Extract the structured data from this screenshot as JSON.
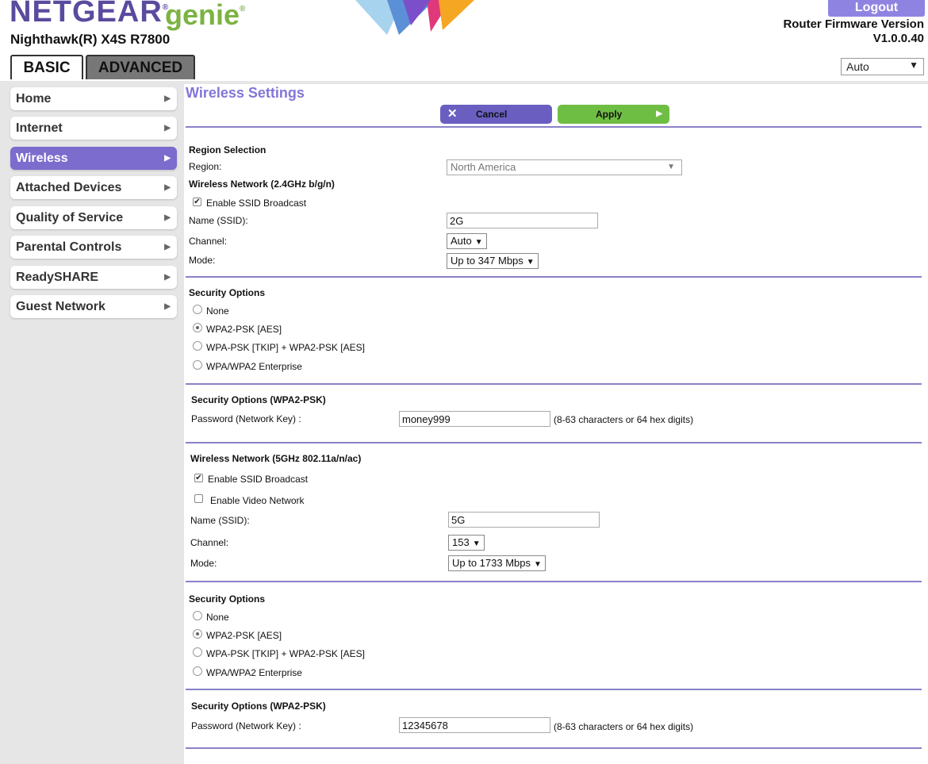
{
  "header": {
    "brand": "NETGEAR",
    "brand_mark": "®",
    "product": "genie",
    "product_mark": "®",
    "model": "Nighthawk(R) X4S R7800",
    "logout_label": "Logout",
    "firmware_label": "Router Firmware Version",
    "firmware_version": "V1.0.0.40",
    "colors": {
      "brand": "#5b4b9e",
      "genie": "#7cb342",
      "accent": "#7b6cce",
      "apply": "#6fbe44"
    }
  },
  "tabs": [
    {
      "label": "BASIC",
      "active": true
    },
    {
      "label": "ADVANCED",
      "active": false
    }
  ],
  "language": {
    "value": "Auto"
  },
  "sidebar": {
    "items": [
      {
        "label": "Home",
        "active": false
      },
      {
        "label": "Internet",
        "active": false
      },
      {
        "label": "Wireless",
        "active": true
      },
      {
        "label": "Attached Devices",
        "active": false
      },
      {
        "label": "Quality of Service",
        "active": false
      },
      {
        "label": "Parental Controls",
        "active": false
      },
      {
        "label": "ReadySHARE",
        "active": false
      },
      {
        "label": "Guest Network",
        "active": false
      }
    ]
  },
  "main": {
    "title": "Wireless Settings",
    "cancel_label": "Cancel",
    "apply_label": "Apply",
    "region": {
      "heading": "Region Selection",
      "label": "Region:",
      "value": "North America"
    },
    "net24": {
      "heading": "Wireless Network (2.4GHz b/g/n)",
      "enable_ssid": "Enable SSID Broadcast",
      "enable_ssid_checked": true,
      "name_label": "Name (SSID):",
      "name_value": "2G",
      "channel_label": "Channel:",
      "channel_value": "Auto",
      "mode_label": "Mode:",
      "mode_value": "Up to 347 Mbps"
    },
    "sec24": {
      "heading": "Security Options",
      "options": [
        "None",
        "WPA2-PSK [AES]",
        "WPA-PSK [TKIP] + WPA2-PSK [AES]",
        "WPA/WPA2 Enterprise"
      ],
      "selected": 1
    },
    "psk24": {
      "heading": "Security Options (WPA2-PSK)",
      "label": "Password (Network Key) :",
      "value": "money999",
      "hint": "(8-63 characters or 64 hex digits)"
    },
    "net5": {
      "heading": "Wireless Network (5GHz 802.11a/n/ac)",
      "enable_ssid": "Enable SSID Broadcast",
      "enable_ssid_checked": true,
      "enable_video": "Enable Video Network",
      "enable_video_checked": false,
      "name_label": "Name (SSID):",
      "name_value": "5G",
      "channel_label": "Channel:",
      "channel_value": "153",
      "mode_label": "Mode:",
      "mode_value": "Up to 1733 Mbps"
    },
    "sec5": {
      "heading": "Security Options",
      "options": [
        "None",
        "WPA2-PSK [AES]",
        "WPA-PSK [TKIP] + WPA2-PSK [AES]",
        "WPA/WPA2 Enterprise"
      ],
      "selected": 1
    },
    "psk5": {
      "heading": "Security Options (WPA2-PSK)",
      "label": "Password (Network Key) :",
      "value": "12345678",
      "hint": "(8-63 characters or 64 hex digits)"
    }
  }
}
